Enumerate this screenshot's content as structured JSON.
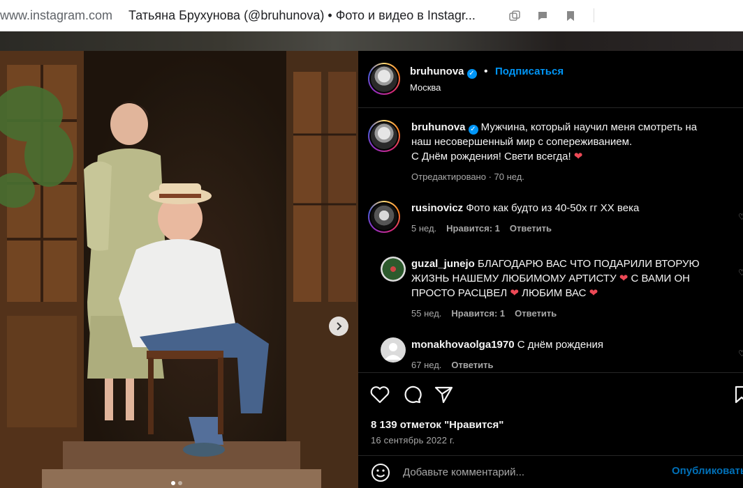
{
  "browser": {
    "url": "www.instagram.com",
    "title": "Татьяна Брухунова (@bruhunova) • Фото и видео в Instagr..."
  },
  "post": {
    "author": "bruhunova",
    "follow_label": "Подписаться",
    "separator": "•",
    "location": "Москва"
  },
  "comments": [
    {
      "user": "bruhunova",
      "verified": true,
      "text_line1": "Мужчина, который научил меня смотреть на",
      "text_line2": "наш несовершенный мир с сопереживанием.",
      "text_line3": "С Днём рождения! Свети всегда! ",
      "heart": "❤",
      "meta": "Отредактировано · 70 нед."
    },
    {
      "user": "rusinovicz",
      "text": "Фото как будто из 40-50х гг XX века",
      "age": "5 нед.",
      "likes": "Нравится: 1",
      "reply": "Ответить"
    },
    {
      "user": "guzal_junejo",
      "text_line1": "БЛАГОДАРЮ ВАС ЧТО ПОДАРИЛИ ВТОРУЮ",
      "text_line2": "ЖИЗНЬ НАШЕМУ ЛЮБИМОМУ АРТИСТУ ",
      "text_line2b": " С ВАМИ ОН",
      "text_line3": "ПРОСТО РАСЦВЕЛ ",
      "text_line3b": " ЛЮБИМ ВАС ",
      "heart": "❤",
      "age": "55 нед.",
      "likes": "Нравится: 1",
      "reply": "Ответить"
    },
    {
      "user": "monakhovaolga1970",
      "text": "С днём рождения",
      "age": "67 нед.",
      "reply": "Ответить"
    }
  ],
  "actions": {
    "likes_count": "8 139 отметок \"Нравится\"",
    "date": "16 сентябрь 2022 г."
  },
  "add_comment": {
    "placeholder": "Добавьте комментарий...",
    "publish_label": "Опубликовать"
  },
  "icons": {
    "like": "heart-icon",
    "comment": "comment-icon",
    "share": "share-icon",
    "save": "bookmark-icon",
    "emoji": "emoji-icon",
    "next": "chevron-right-icon"
  },
  "colors": {
    "link_blue": "#0095f6",
    "heart_red": "#ed4956",
    "muted_text": "#a8a8a8"
  }
}
